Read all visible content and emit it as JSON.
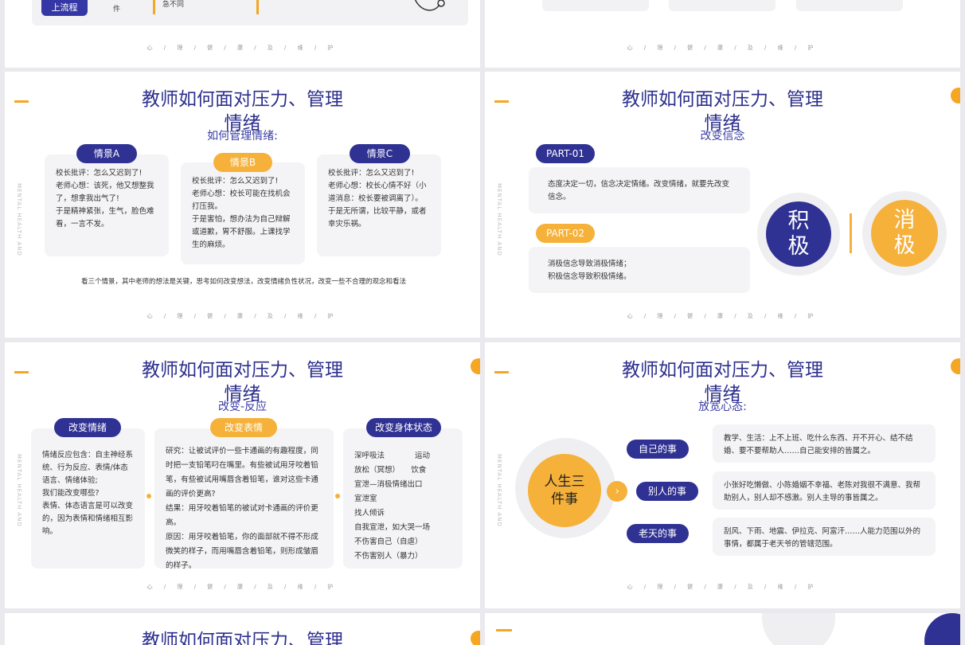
{
  "top_left": {
    "button": "上流程",
    "col_text": "件",
    "note": "急不同",
    "footer": "心 / 理 / 健 / 康 / 及 / 维 / 护"
  },
  "top_right": {
    "footer": "心 / 理 / 健 / 康 / 及 / 维 / 护"
  },
  "slides": {
    "title_line1": "教师如何面对压力、管理",
    "title_line2": "情绪",
    "watermark": "MENTAL HEALTH AND",
    "footer": "心 / 理 / 健 / 康 / 及 / 维 / 护",
    "s1": {
      "subtitle": "如何管理情绪:",
      "cards": [
        {
          "label": "情景A",
          "text": "校长批评：怎么又迟到了!\n老师心想：该死，他又想整我了，想拿我出气了!\n于是精神紧张，生气，脸色难看，一言不发。"
        },
        {
          "label": "情景B",
          "text": "校长批评：怎么又迟到了!\n老师心想：校长可能在找机会打压我。\n于是害怕，想办法为自己辩解或道歉，胃不舒服。上课找学生的麻烦。"
        },
        {
          "label": "情景C",
          "text": "校长批评：怎么又迟到了!\n老师心想：校长心情不好（小道消息：校长要被调离了）。\n于是无所谓，比较平静，或者幸灾乐祸。"
        }
      ],
      "caption": "看三个情景，其中老师的想法是关键，思考如何改变想法，改变情绪负性状况，改变一些不合理的观念和看法"
    },
    "s2": {
      "subtitle": "改变信念",
      "parts": [
        {
          "label": "PART-01",
          "text": "态度决定一切，信念决定情绪。改变情绪，就要先改变信念。"
        },
        {
          "label": "PART-02",
          "text": "消极信念导致消极情绪；\n积极信念导致积极情绪。"
        }
      ],
      "positive": "积极",
      "negative": "消极"
    },
    "s3": {
      "subtitle": "改变-反应",
      "cols": [
        {
          "label": "改变情绪",
          "text": "情绪反应包含：自主神经系统、行为反应、表情/体态语言、情绪体验;\n我们能改变哪些?\n表情、体态语言是可以改变的，因为表情和情绪相互影响。"
        },
        {
          "label": "改变表情",
          "text": "研究：让被试评价一些卡通画的有趣程度，同时把一支铅笔叼在嘴里。有些被试用牙咬着铅笔，有些被试用嘴唇含着铅笔，谁对这些卡通画的评价更高?\n结果：用牙咬着铅笔的被试对卡通画的评价更高。\n原因：用牙咬着铅笔，你的面部就不得不形成微笑的样子，而用嘴唇含着铅笔，则形成皱眉的样子。"
        },
        {
          "label": "改变身体状态",
          "text": "深呼吸法　　　　运动\n放松（冥想）　　饮食\n宣泄—消极情绪出口\n宣泄室\n找人倾诉\n自我宣泄，如大哭一场\n不伤害自己（自虐）\n不伤害别人（暴力）"
        }
      ]
    },
    "s4": {
      "subtitle": "放宽心态:",
      "center": "人生三件事",
      "items": [
        {
          "label": "自己的事",
          "text": "教学、生活：上不上班、吃什么东西、开不开心、结不结婚、要不要帮助人……自己能安排的皆属之。"
        },
        {
          "label": "别人的事",
          "text": "小张好吃懒做、小陈婚姻不幸福、老陈对我很不满意、我帮助别人，别人却不感激。别人主导的事皆属之。"
        },
        {
          "label": "老天的事",
          "text": "刮风、下雨、地震、伊拉克、阿富汗……人能力范围以外的事情，都属于老天爷的管辖范围。"
        }
      ]
    }
  },
  "colors": {
    "primary": "#2f3193",
    "accent": "#f5b13a",
    "card": "#f4f4f6"
  }
}
